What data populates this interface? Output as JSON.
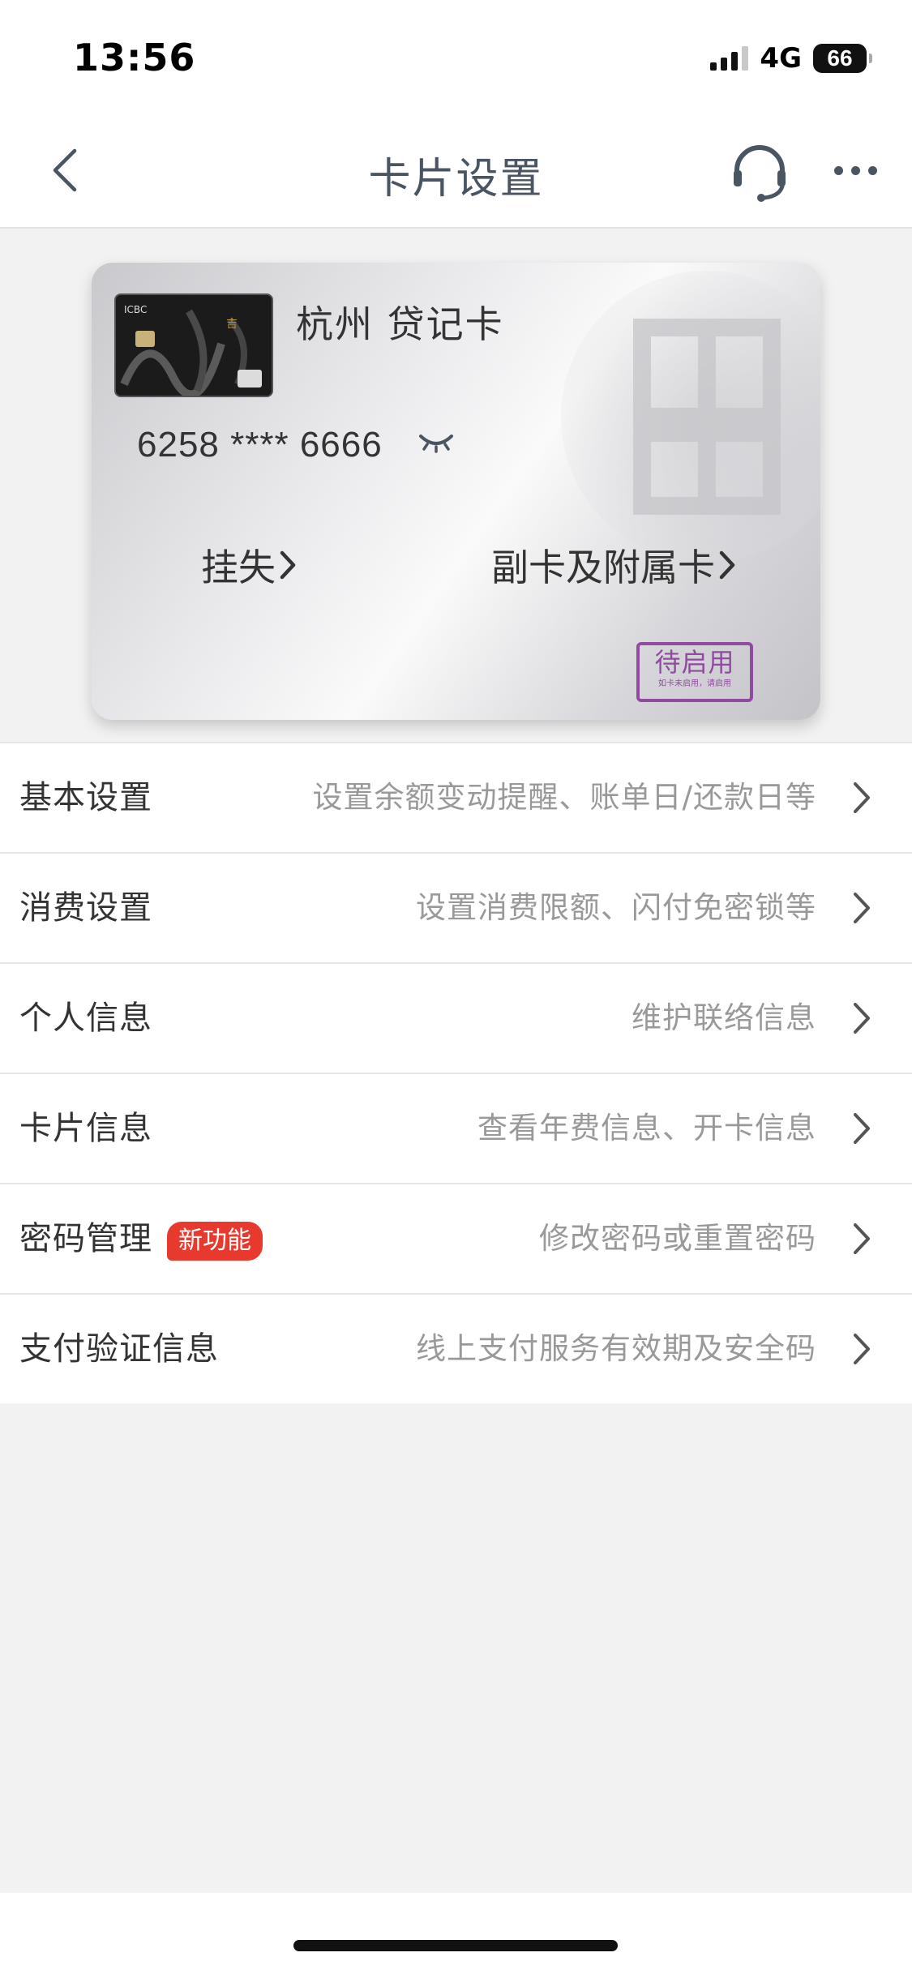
{
  "status_bar": {
    "time": "13:56",
    "network": "4G",
    "battery": "66"
  },
  "header": {
    "title": "卡片设置",
    "back_icon": "chevron-left-icon",
    "service_icon": "headset-icon",
    "more_icon": "more-dots-icon"
  },
  "card": {
    "name": "杭州 贷记卡",
    "number": "6258 **** 6666",
    "eye_icon": "eye-closed-icon",
    "action_left": "挂失",
    "action_right": "副卡及附属卡",
    "stamp_main": "待启用",
    "stamp_sub": "如卡未启用，请启用",
    "thumb_brand": "ICBC"
  },
  "settings": [
    {
      "label": "基本设置",
      "desc": "设置余额变动提醒、账单日/还款日等"
    },
    {
      "label": "消费设置",
      "desc": "设置消费限额、闪付免密锁等"
    },
    {
      "label": "个人信息",
      "desc": "维护联络信息"
    },
    {
      "label": "卡片信息",
      "desc": "查看年费信息、开卡信息"
    },
    {
      "label": "密码管理",
      "badge": "新功能",
      "desc": "修改密码或重置密码"
    },
    {
      "label": "支付验证信息",
      "desc": "线上支付服务有效期及安全码"
    }
  ],
  "colors": {
    "accent_red": "#e8392f",
    "header_text": "#4a5563",
    "desc_text": "#999999",
    "stamp_purple": "#8a3c9a",
    "page_bg": "#f2f2f2"
  }
}
